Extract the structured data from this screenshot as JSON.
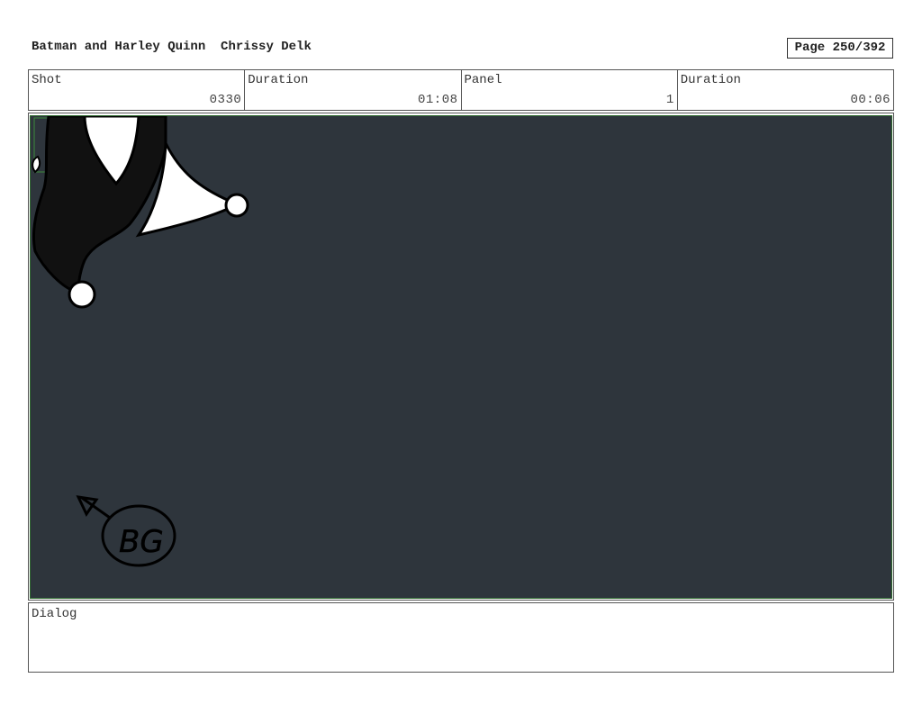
{
  "header": {
    "project_title": "Batman and Harley Quinn",
    "artist": "Chrissy Delk",
    "page": "Page 250/392"
  },
  "info": {
    "shot_label": "Shot",
    "shot_value": "0330",
    "shot_duration_label": "Duration",
    "shot_duration_value": "01:08",
    "panel_label": "Panel",
    "panel_value": "1",
    "panel_duration_label": "Duration",
    "panel_duration_value": "00:06"
  },
  "panel": {
    "background_color": "#2e353c",
    "annotation": "BG"
  },
  "dialog": {
    "label": "Dialog",
    "text": ""
  }
}
